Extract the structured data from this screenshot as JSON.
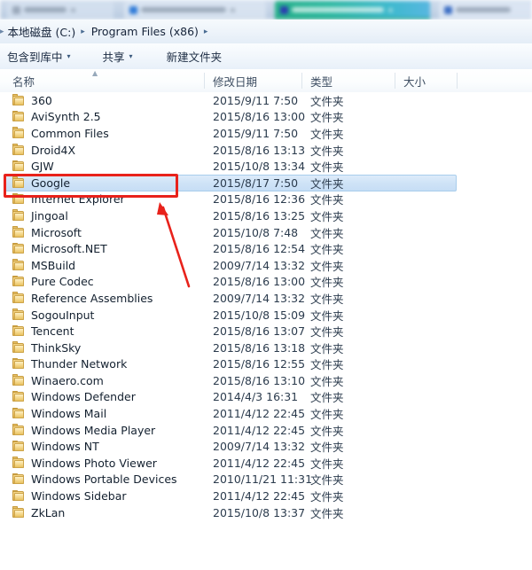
{
  "browser_tabs": [
    {
      "name": "tab-blurred-1",
      "color": "#d6e2f0"
    },
    {
      "name": "tab-blurred-2",
      "color": "#dce6f3"
    },
    {
      "name": "tab-active-teal",
      "color": "#2bb8a0"
    },
    {
      "name": "tab-blurred-4",
      "color": "#dee8f4"
    }
  ],
  "address_bar": {
    "lead_separator": "▸",
    "crumbs": [
      {
        "label": "本地磁盘 (C:)"
      },
      {
        "label": "Program Files (x86)"
      }
    ],
    "separator": "▸"
  },
  "toolbar": {
    "include_in_library": "包含到库中",
    "share": "共享",
    "new_folder": "新建文件夹",
    "caret": "▾"
  },
  "columns": {
    "name": "名称",
    "date_modified": "修改日期",
    "type": "类型",
    "size": "大小",
    "sort_indicator": "▲"
  },
  "selection": {
    "selected_row_name": "Google",
    "highlight_color": "#cfe3f7"
  },
  "annotations": {
    "box_color": "#e8221b",
    "arrow_color": "#e8221b",
    "box_target": "Google",
    "arrow_points_to": "Google"
  },
  "files": [
    {
      "name": "360",
      "date": "2015/9/11 7:50",
      "type": "文件夹",
      "size": "",
      "selected": false
    },
    {
      "name": "AviSynth 2.5",
      "date": "2015/8/16 13:00",
      "type": "文件夹",
      "size": "",
      "selected": false
    },
    {
      "name": "Common Files",
      "date": "2015/9/11 7:50",
      "type": "文件夹",
      "size": "",
      "selected": false
    },
    {
      "name": "Droid4X",
      "date": "2015/8/16 13:13",
      "type": "文件夹",
      "size": "",
      "selected": false
    },
    {
      "name": "GJW",
      "date": "2015/10/8 13:34",
      "type": "文件夹",
      "size": "",
      "selected": false
    },
    {
      "name": "Google",
      "date": "2015/8/17 7:50",
      "type": "文件夹",
      "size": "",
      "selected": true
    },
    {
      "name": "Internet Explorer",
      "date": "2015/8/16 12:36",
      "type": "文件夹",
      "size": "",
      "selected": false
    },
    {
      "name": "Jingoal",
      "date": "2015/8/16 13:25",
      "type": "文件夹",
      "size": "",
      "selected": false
    },
    {
      "name": "Microsoft",
      "date": "2015/10/8 7:48",
      "type": "文件夹",
      "size": "",
      "selected": false
    },
    {
      "name": "Microsoft.NET",
      "date": "2015/8/16 12:54",
      "type": "文件夹",
      "size": "",
      "selected": false
    },
    {
      "name": "MSBuild",
      "date": "2009/7/14 13:32",
      "type": "文件夹",
      "size": "",
      "selected": false
    },
    {
      "name": "Pure Codec",
      "date": "2015/8/16 13:00",
      "type": "文件夹",
      "size": "",
      "selected": false
    },
    {
      "name": "Reference Assemblies",
      "date": "2009/7/14 13:32",
      "type": "文件夹",
      "size": "",
      "selected": false
    },
    {
      "name": "SogouInput",
      "date": "2015/10/8 15:09",
      "type": "文件夹",
      "size": "",
      "selected": false
    },
    {
      "name": "Tencent",
      "date": "2015/8/16 13:07",
      "type": "文件夹",
      "size": "",
      "selected": false
    },
    {
      "name": "ThinkSky",
      "date": "2015/8/16 13:18",
      "type": "文件夹",
      "size": "",
      "selected": false
    },
    {
      "name": "Thunder Network",
      "date": "2015/8/16 12:55",
      "type": "文件夹",
      "size": "",
      "selected": false
    },
    {
      "name": "Winaero.com",
      "date": "2015/8/16 13:10",
      "type": "文件夹",
      "size": "",
      "selected": false
    },
    {
      "name": "Windows Defender",
      "date": "2014/4/3 16:31",
      "type": "文件夹",
      "size": "",
      "selected": false
    },
    {
      "name": "Windows Mail",
      "date": "2011/4/12 22:45",
      "type": "文件夹",
      "size": "",
      "selected": false
    },
    {
      "name": "Windows Media Player",
      "date": "2011/4/12 22:45",
      "type": "文件夹",
      "size": "",
      "selected": false
    },
    {
      "name": "Windows NT",
      "date": "2009/7/14 13:32",
      "type": "文件夹",
      "size": "",
      "selected": false
    },
    {
      "name": "Windows Photo Viewer",
      "date": "2011/4/12 22:45",
      "type": "文件夹",
      "size": "",
      "selected": false
    },
    {
      "name": "Windows Portable Devices",
      "date": "2010/11/21 11:31",
      "type": "文件夹",
      "size": "",
      "selected": false
    },
    {
      "name": "Windows Sidebar",
      "date": "2011/4/12 22:45",
      "type": "文件夹",
      "size": "",
      "selected": false
    },
    {
      "name": "ZkLan",
      "date": "2015/10/8 13:37",
      "type": "文件夹",
      "size": "",
      "selected": false
    }
  ]
}
